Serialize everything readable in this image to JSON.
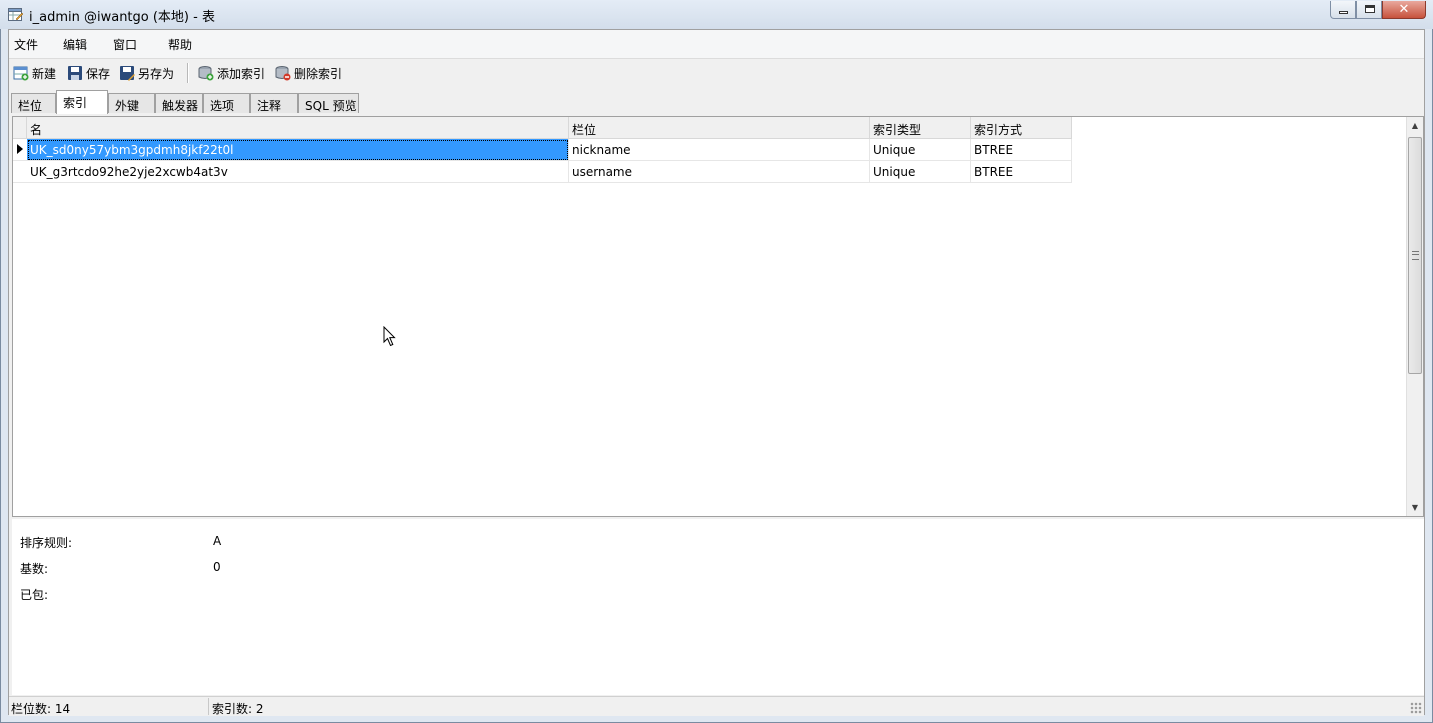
{
  "window": {
    "title": "i_admin @iwantgo (本地) - 表"
  },
  "menu": {
    "items": [
      "文件",
      "编辑",
      "窗口",
      "帮助"
    ]
  },
  "toolbar": {
    "new_label": "新建",
    "save_label": "保存",
    "save_as_label": "另存为",
    "add_index_label": "添加索引",
    "delete_index_label": "删除索引"
  },
  "tabs": [
    "栏位",
    "索引",
    "外键",
    "触发器",
    "选项",
    "注释",
    "SQL 预览"
  ],
  "active_tab": "索引",
  "grid": {
    "columns": [
      "名",
      "栏位",
      "索引类型",
      "索引方式"
    ],
    "rows": [
      [
        "UK_sd0ny57ybm3gpdmh8jkf22t0l",
        "nickname",
        "Unique",
        "BTREE"
      ],
      [
        "UK_g3rtcdo92he2yje2xcwb4at3v",
        "username",
        "Unique",
        "BTREE"
      ]
    ]
  },
  "details": {
    "collation_label": "排序规则:",
    "collation_value": "A",
    "cardinality_label": "基数:",
    "cardinality_value": "0",
    "packed_label": "已包:",
    "packed_value": ""
  },
  "status": {
    "field_count": "栏位数: 14",
    "index_count": "索引数: 2"
  },
  "colors": {
    "selection": "#3399ff",
    "titlebar": "#dfe7f1",
    "close_button": "#c7523c"
  }
}
